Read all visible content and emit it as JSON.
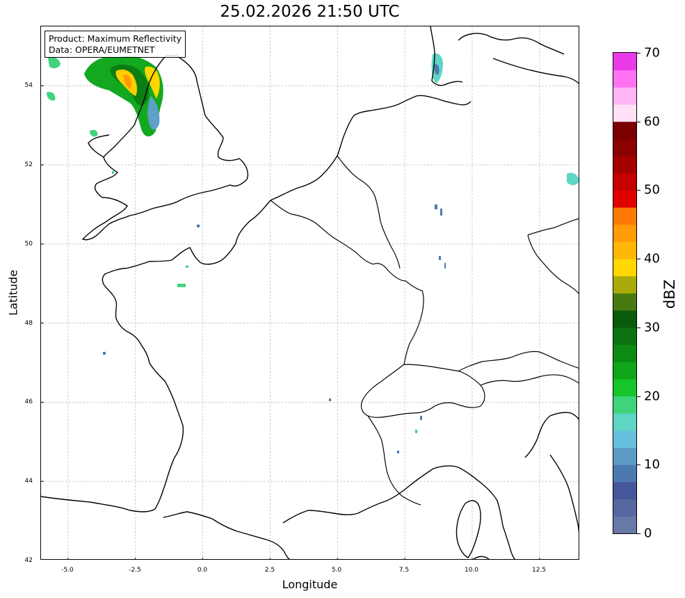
{
  "title": "25.02.2026 21:50 UTC",
  "info": {
    "product": "Product: Maximum Reflectivity",
    "source": "Data: OPERA/EUMETNET"
  },
  "axes": {
    "xlabel": "Longitude",
    "ylabel": "Latitude",
    "xlim": [
      -6,
      14
    ],
    "ylim": [
      42,
      55.5
    ],
    "xticks": [
      "-5.0",
      "-2.5",
      "0.0",
      "2.5",
      "5.0",
      "7.5",
      "10.0",
      "12.5"
    ],
    "yticks": [
      "42",
      "44",
      "46",
      "48",
      "50",
      "52",
      "54"
    ],
    "grid": "on (dashed, grey)"
  },
  "colorbar": {
    "label": "dBZ",
    "ticks": [
      "0",
      "10",
      "20",
      "30",
      "40",
      "50",
      "60",
      "70"
    ],
    "range": [
      0,
      70
    ],
    "step": 2.5,
    "colors": [
      "#6878a8",
      "#5767a0",
      "#44579a",
      "#4d7aae",
      "#5c9bc6",
      "#66c0dc",
      "#5fd5c4",
      "#3fd37c",
      "#15c52a",
      "#11a51a",
      "#0c8a12",
      "#0d7212",
      "#0a5a0c",
      "#487a10",
      "#aaab0b",
      "#ffd600",
      "#ffb705",
      "#ff9b05",
      "#ff7a00",
      "#e10000",
      "#c40000",
      "#a40000",
      "#8b0000",
      "#7a0000",
      "#ffe0f4",
      "#ffb4f4",
      "#ff73f2",
      "#ea3be8"
    ]
  },
  "map": {
    "region": "Western Europe (France, UK, Benelux, Germany, Switzerland, Italy)",
    "precip_areas": [
      "north-west England / Irish Sea (up to ~45 dBZ)",
      "Wales coast",
      "northern Germany coast",
      "eastern Germany edge"
    ]
  }
}
